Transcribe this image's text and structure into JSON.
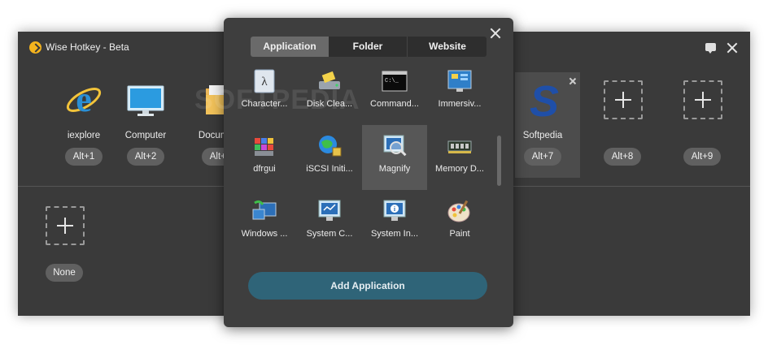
{
  "app": {
    "title": "Wise Hotkey - Beta"
  },
  "hotkeys": [
    {
      "label": "iexplore",
      "key": "Alt+1"
    },
    {
      "label": "Computer",
      "key": "Alt+2"
    },
    {
      "label": "Documents",
      "key": "Alt+3"
    },
    {
      "label": "Softpedia",
      "key": "Alt+7"
    },
    {
      "label": "",
      "key": "Alt+8"
    },
    {
      "label": "",
      "key": "Alt+9"
    },
    {
      "label": "",
      "key": "None"
    }
  ],
  "panel": {
    "tabs": [
      "Application",
      "Folder",
      "Website"
    ],
    "active_tab": "Application",
    "apps": [
      "Character...",
      "Disk Clea...",
      "Command...",
      "Immersiv...",
      "dfrgui",
      "iSCSI Initi...",
      "Magnify",
      "Memory D...",
      "Windows ...",
      "System C...",
      "System In...",
      "Paint"
    ],
    "highlighted_app": "Magnify",
    "add_button": "Add Application"
  },
  "watermark": "SOFTPEDIA"
}
